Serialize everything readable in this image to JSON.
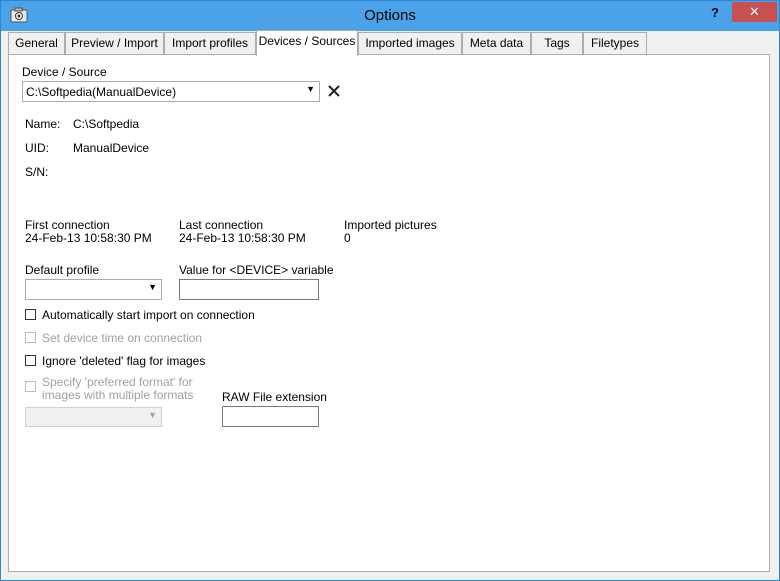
{
  "window": {
    "title": "Options",
    "help_label": "?",
    "close_label": "✕"
  },
  "tabs": [
    {
      "label": "General"
    },
    {
      "label": "Preview / Import"
    },
    {
      "label": "Import profiles"
    },
    {
      "label": "Devices / Sources"
    },
    {
      "label": "Imported images"
    },
    {
      "label": "Meta data"
    },
    {
      "label": "Tags"
    },
    {
      "label": "Filetypes"
    }
  ],
  "device": {
    "section_label": "Device / Source",
    "selected": "C:\\Softpedia(ManualDevice)",
    "name_label": "Name:",
    "name_value": "C:\\Softpedia",
    "uid_label": "UID:",
    "uid_value": "ManualDevice",
    "sn_label": "S/N:",
    "sn_value": ""
  },
  "stats": {
    "first_label": "First connection",
    "first_value": "24-Feb-13 10:58:30 PM",
    "last_label": "Last connection",
    "last_value": "24-Feb-13 10:58:30 PM",
    "imported_label": "Imported pictures",
    "imported_value": "0"
  },
  "profile": {
    "default_profile_label": "Default profile",
    "default_profile_value": "",
    "device_var_label": "Value for <DEVICE> variable",
    "device_var_value": ""
  },
  "options": {
    "auto_start": "Automatically start import on connection",
    "set_time": "Set device time on connection",
    "ignore_deleted": "Ignore 'deleted' flag for images",
    "preferred_format_line1": "Specify 'preferred format' for",
    "preferred_format_line2": "images with multiple formats",
    "raw_ext_label": "RAW File extension",
    "raw_ext_value": ""
  }
}
